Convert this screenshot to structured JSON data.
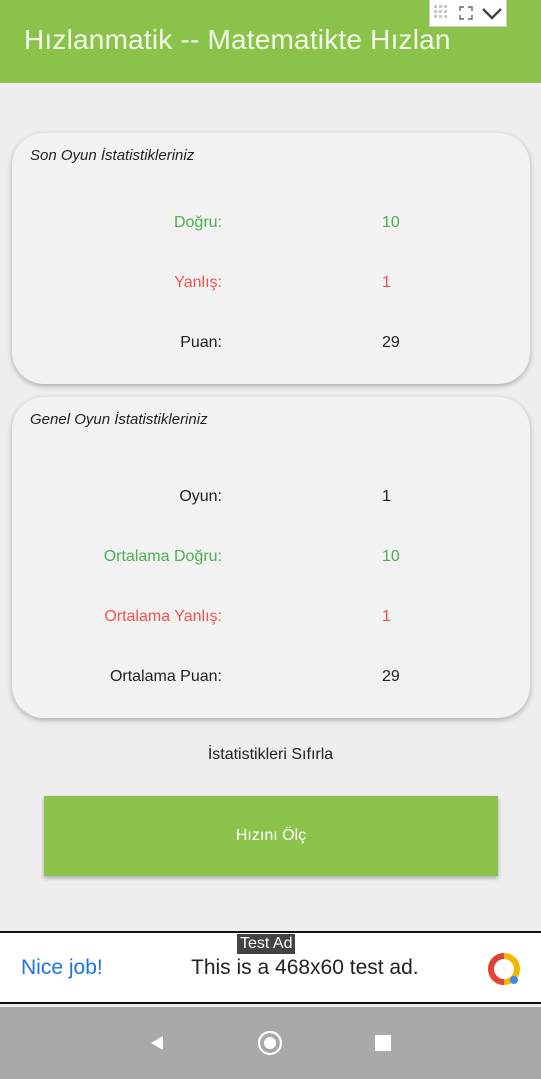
{
  "app_bar": {
    "title": "Hızlanmatik -- Matematikte Hızlan"
  },
  "last_game": {
    "title": "Son Oyun İstatistikleriniz",
    "rows": [
      {
        "label": "Doğru:",
        "value": "10"
      },
      {
        "label": "Yanlış:",
        "value": "1"
      },
      {
        "label": "Puan:",
        "value": "29"
      }
    ]
  },
  "general": {
    "title": "Genel Oyun İstatistikleriniz",
    "rows": [
      {
        "label": "Oyun:",
        "value": "1"
      },
      {
        "label": "Ortalama Doğru:",
        "value": "10"
      },
      {
        "label": "Ortalama Yanlış:",
        "value": "1"
      },
      {
        "label": "Ortalama Puan:",
        "value": "29"
      }
    ]
  },
  "reset_label": "İstatistikleri Sıfırla",
  "measure_button": "Hızını Ölç",
  "ad": {
    "tag": "Test Ad",
    "headline": "Nice job!",
    "body": "This is a 468x60 test ad."
  },
  "colors": {
    "accent": "#8bc34a",
    "correct": "#4caf50",
    "wrong": "#ef5350"
  },
  "icons": [
    "grid-icon",
    "expand-icon",
    "chevron-down-icon",
    "ad-logo-icon",
    "back-icon",
    "home-icon",
    "recents-icon"
  ]
}
